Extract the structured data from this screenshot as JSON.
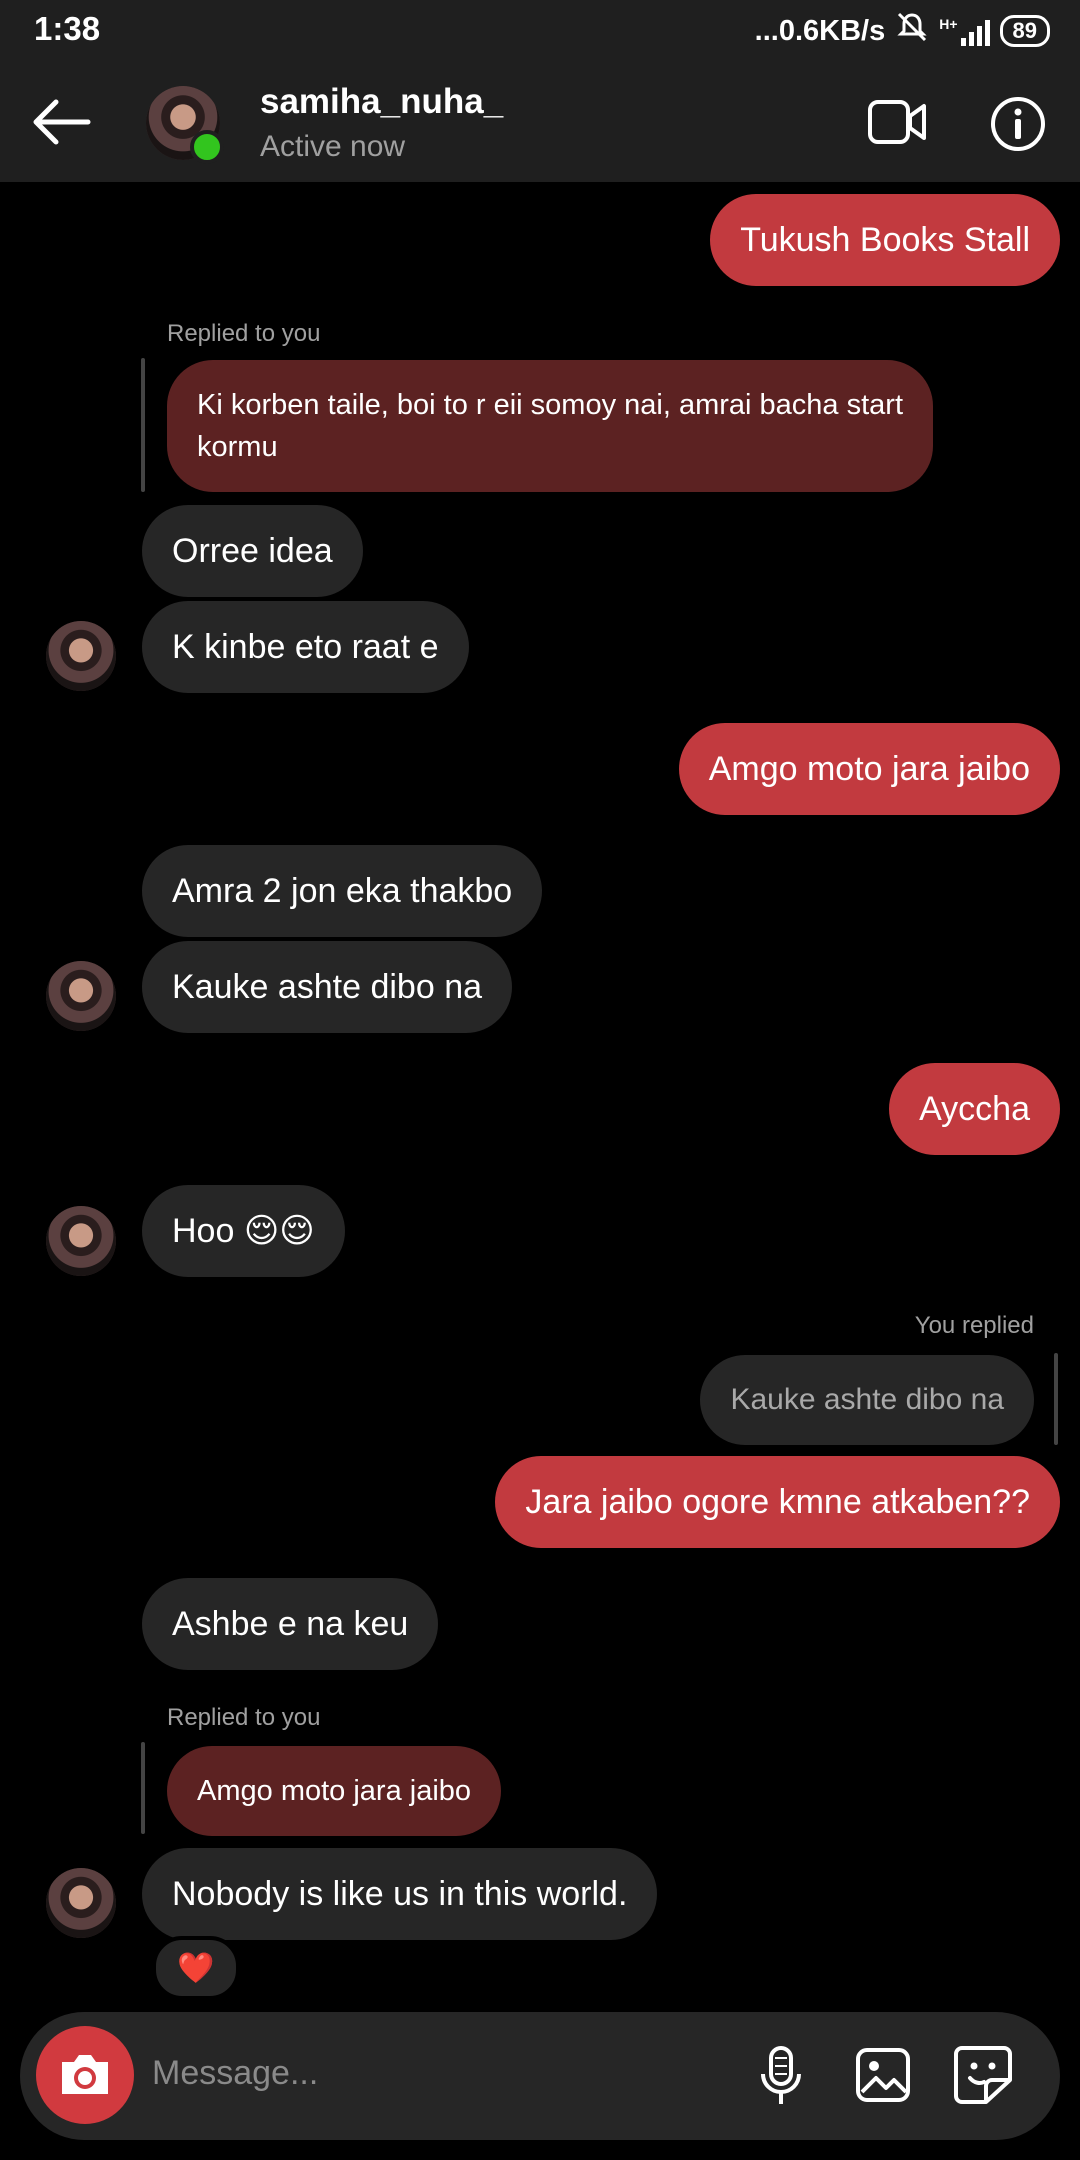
{
  "status_bar": {
    "time": "1:38",
    "network_speed": "...0.6KB/s",
    "network_type": "H+",
    "battery": "89"
  },
  "header": {
    "username": "samiha_nuha_",
    "status": "Active now"
  },
  "icons": {
    "back": "arrow-left-icon",
    "video": "video-call-icon",
    "info": "info-icon",
    "camera": "camera-icon",
    "mic": "microphone-icon",
    "gallery": "image-icon",
    "sticker": "sticker-icon"
  },
  "messages": {
    "m1": "Tukush Books Stall",
    "r1_label": "Replied to you",
    "r1_quote": "Ki korben taile, boi to r eii somoy nai, amrai bacha start kormu",
    "m2": "Orree idea",
    "m3": "K kinbe eto raat e",
    "m4": "Amgo moto jara jaibo",
    "m5": "Amra 2 jon eka thakbo",
    "m6": "Kauke ashte dibo na",
    "m7": "Ayccha",
    "m8": "Hoo 😌😌",
    "r2_label": "You replied",
    "r2_quote": "Kauke ashte dibo na",
    "m9": "Jara jaibo ogore kmne atkaben??",
    "m10": "Ashbe e na keu",
    "r3_label": "Replied to you",
    "r3_quote": "Amgo moto jara jaibo",
    "m11": "Nobody is like us in this world.",
    "reaction": "❤️"
  },
  "composer": {
    "placeholder": "Message..."
  },
  "colors": {
    "accent": "#c23a3f",
    "bubble_theirs": "#262626",
    "online": "#32c51e"
  }
}
